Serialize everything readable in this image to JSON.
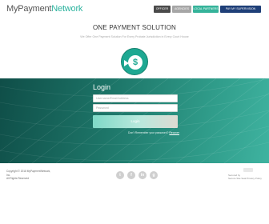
{
  "header": {
    "logo_part1": "MyPayment",
    "logo_part2": "Network",
    "nav": [
      "OFFICER",
      "AGENCIES",
      "LOCAL PARTNERS",
      "PAY MY SUPERVISION"
    ]
  },
  "hero": {
    "title": "ONE PAYMENT SOLUTION",
    "subtitle": "We Offer One Payment Solution For Every Probate Jurisdiction in Every Court House"
  },
  "login": {
    "title": "Login",
    "username_placeholder": "Username/Email Address",
    "password_placeholder": "Password",
    "button": "Login",
    "forgot_text": "Don't Remember your password?",
    "forgot_link": "Recover"
  },
  "footer": {
    "copyright_line1": "Copyright © 2018 MyPaymentNetwork,",
    "copyright_line2": "Inc.",
    "copyright_line3": "All Rights Reserved",
    "social": [
      "twitter-icon",
      "facebook-icon",
      "linkedin-icon",
      "google-plus-icon"
    ],
    "social_glyphs": [
      "t",
      "f",
      "in",
      "g"
    ],
    "secure_line1": "Secured by",
    "secure_line2": "Secure Site Seal Privacy Policy"
  },
  "colors": {
    "accent": "#2bb39e",
    "panel_dark": "#0f4e48",
    "panel_light": "#3fb3a0",
    "nav_blue": "#1e3f78"
  }
}
